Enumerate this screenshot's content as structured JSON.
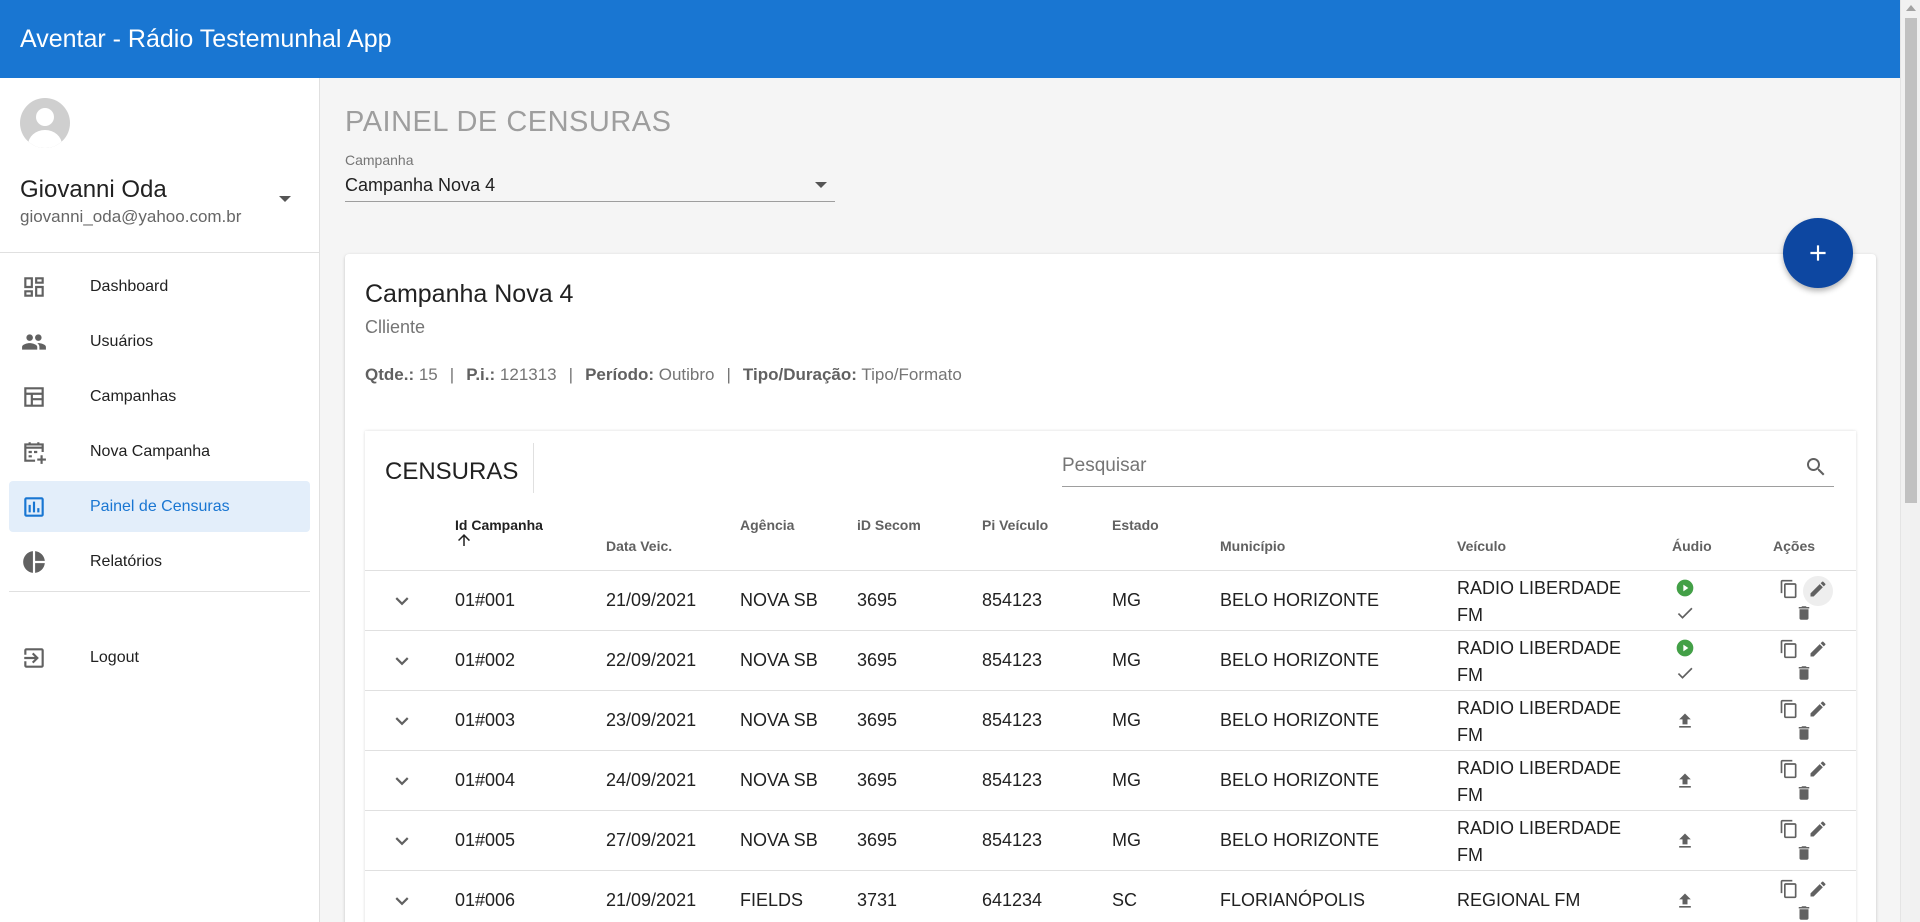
{
  "app": {
    "title": "Aventar - Rádio Testemunhal App"
  },
  "user": {
    "name": "Giovanni Oda",
    "email": "giovanni_oda@yahoo.com.br"
  },
  "sidebar": {
    "items": [
      {
        "label": "Dashboard",
        "icon": "dashboard-icon",
        "active": false
      },
      {
        "label": "Usuários",
        "icon": "people-icon",
        "active": false
      },
      {
        "label": "Campanhas",
        "icon": "table-icon",
        "active": false
      },
      {
        "label": "Nova Campanha",
        "icon": "calendar-add-icon",
        "active": false
      },
      {
        "label": "Painel de Censuras",
        "icon": "bar-chart-icon",
        "active": true
      },
      {
        "label": "Relatórios",
        "icon": "pie-chart-icon",
        "active": false
      }
    ],
    "logout_label": "Logout"
  },
  "page": {
    "title": "PAINEL DE CENSURAS",
    "campaign_select_label": "Campanha",
    "campaign_select_value": "Campanha Nova 4"
  },
  "campaign": {
    "name": "Campanha Nova 4",
    "client": "Clliente",
    "qtde_label": "Qtde.:",
    "qtde": "15",
    "pi_label": "P.i.:",
    "pi": "121313",
    "periodo_label": "Período:",
    "periodo": "Outibro",
    "tipo_label": "Tipo/Duração:",
    "tipo": "Tipo/Formato"
  },
  "table": {
    "title": "CENSURAS",
    "search_placeholder": "Pesquisar",
    "headers": {
      "id_campanha": "Id Campanha",
      "data_veic": "Data Veic.",
      "agencia": "Agência",
      "id_secom": "iD Secom",
      "pi_veiculo": "Pi Veículo",
      "estado": "Estado",
      "municipio": "Município",
      "veiculo": "Veículo",
      "audio": "Áudio",
      "acoes": "Ações"
    },
    "rows": [
      {
        "id": "01#001",
        "data": "21/09/2021",
        "agencia": "NOVA SB",
        "secom": "3695",
        "pi": "854123",
        "estado": "MG",
        "municipio": "BELO HORIZONTE",
        "veiculo": "RADIO LIBERDADE FM",
        "audio": "play-approved"
      },
      {
        "id": "01#002",
        "data": "22/09/2021",
        "agencia": "NOVA SB",
        "secom": "3695",
        "pi": "854123",
        "estado": "MG",
        "municipio": "BELO HORIZONTE",
        "veiculo": "RADIO LIBERDADE FM",
        "audio": "play-approved"
      },
      {
        "id": "01#003",
        "data": "23/09/2021",
        "agencia": "NOVA SB",
        "secom": "3695",
        "pi": "854123",
        "estado": "MG",
        "municipio": "BELO HORIZONTE",
        "veiculo": "RADIO LIBERDADE FM",
        "audio": "upload"
      },
      {
        "id": "01#004",
        "data": "24/09/2021",
        "agencia": "NOVA SB",
        "secom": "3695",
        "pi": "854123",
        "estado": "MG",
        "municipio": "BELO HORIZONTE",
        "veiculo": "RADIO LIBERDADE FM",
        "audio": "upload"
      },
      {
        "id": "01#005",
        "data": "27/09/2021",
        "agencia": "NOVA SB",
        "secom": "3695",
        "pi": "854123",
        "estado": "MG",
        "municipio": "BELO HORIZONTE",
        "veiculo": "RADIO LIBERDADE FM",
        "audio": "upload"
      },
      {
        "id": "01#006",
        "data": "21/09/2021",
        "agencia": "FIELDS",
        "secom": "3731",
        "pi": "641234",
        "estado": "SC",
        "municipio": "FLORIANÓPOLIS",
        "veiculo": "REGIONAL FM",
        "audio": "upload"
      }
    ]
  },
  "colors": {
    "primary": "#1976d2",
    "fab": "#0d47a1",
    "play_green": "#43a047",
    "active_bg": "#e3eefa"
  }
}
